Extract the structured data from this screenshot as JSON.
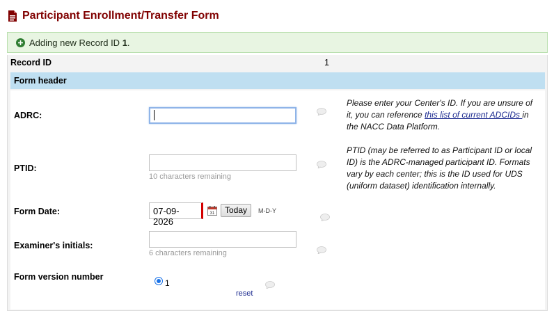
{
  "title": "Participant Enrollment/Transfer Form",
  "notice": {
    "prefix": "Adding new Record ID ",
    "record_id": "1",
    "suffix": "."
  },
  "record": {
    "label": "Record ID",
    "value": "1"
  },
  "section_header": "Form header",
  "fields": {
    "adrc": {
      "label": "ADRC:",
      "value": "",
      "note_before": "Please enter your Center's ID. If you are unsure of it, you can reference ",
      "note_link": "this list of current ADCIDs ",
      "note_after": "in the NACC Data Platform."
    },
    "ptid": {
      "label": "PTID:",
      "value": "",
      "hint": "10 characters remaining",
      "note": "PTID (may be referred to as Participant ID or local ID) is the ADRC-managed participant ID. Formats vary by each center; this is the ID used for UDS (uniform dataset) identification internally."
    },
    "form_date": {
      "label": "Form Date:",
      "value": "07-09-2026",
      "today_label": "Today",
      "format": "M-D-Y"
    },
    "examiner": {
      "label": "Examiner's initials:",
      "value": "",
      "hint": "6 characters remaining"
    },
    "form_version": {
      "label": "Form version number",
      "option": "1",
      "selected": true,
      "reset_label": "reset"
    }
  },
  "colors": {
    "title": "#800000",
    "notice_bg": "#e8f5e2",
    "section_bg": "#bfdff1",
    "link": "#1b2a8f",
    "radio": "#1b73e8"
  },
  "icons": [
    "document-icon",
    "plus-circle-icon",
    "calendar-icon",
    "comment-bubble-icon"
  ]
}
